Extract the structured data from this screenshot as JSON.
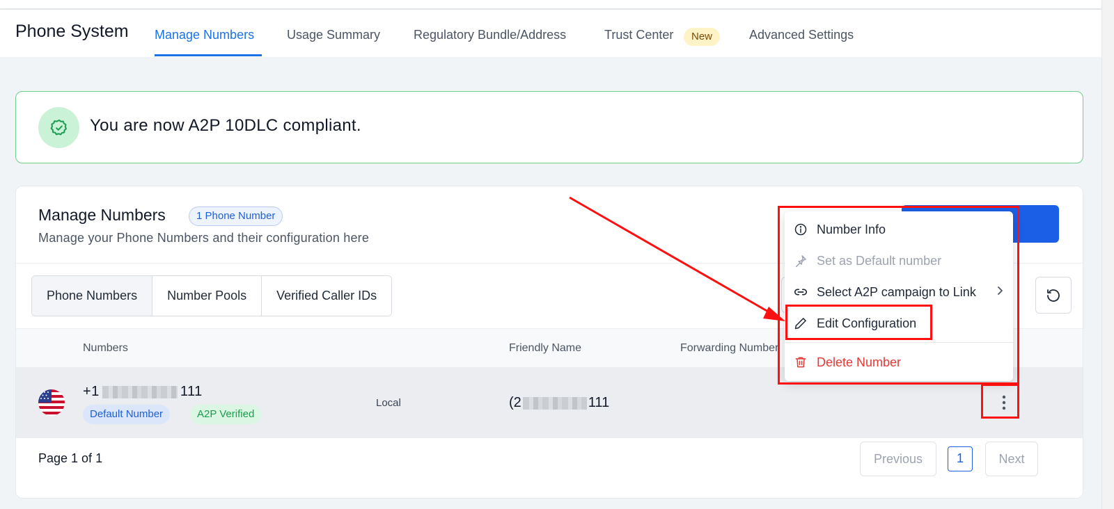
{
  "header": {
    "app_title": "Phone System",
    "tabs": [
      {
        "label": "Manage Numbers",
        "active": true
      },
      {
        "label": "Usage Summary"
      },
      {
        "label": "Regulatory Bundle/Address"
      },
      {
        "label": "Trust Center"
      },
      {
        "label": "Advanced Settings"
      }
    ],
    "trust_center_badge": "New"
  },
  "banner": {
    "text": "You are now A2P 10DLC compliant.",
    "icon": "shield-check-icon"
  },
  "manage": {
    "title": "Manage Numbers",
    "count_badge": "1 Phone Number",
    "subtitle": "Manage your Phone Numbers and their configuration here",
    "segments": [
      "Phone Numbers",
      "Number Pools",
      "Verified Caller IDs"
    ],
    "columns": {
      "numbers": "Numbers",
      "friendly_name": "Friendly Name",
      "forwarding_number": "Forwarding Number"
    },
    "row": {
      "number_prefix": "+1",
      "number_suffix": "111",
      "tag_default": "Default Number",
      "tag_a2p": "A2P Verified",
      "type": "Local",
      "friendly_prefix": "(2",
      "friendly_suffix": "111"
    },
    "pagination": {
      "page_text": "Page 1 of 1",
      "previous": "Previous",
      "current": "1",
      "next": "Next"
    }
  },
  "context_menu": {
    "items": [
      {
        "label": "Number Info",
        "icon": "info-icon"
      },
      {
        "label": "Set as Default number",
        "icon": "pin-icon",
        "disabled": true
      },
      {
        "label": "Select A2P campaign to Link",
        "icon": "link-icon"
      },
      {
        "label": "Edit Configuration",
        "icon": "pencil-icon"
      },
      {
        "label": "Delete Number",
        "icon": "trash-icon",
        "danger": true
      }
    ]
  },
  "colors": {
    "accent": "#1a73e8",
    "primary_button": "#1a5fe6",
    "success_border": "#6ed08a",
    "danger": "#e53935",
    "annotation": "#ff1010"
  }
}
